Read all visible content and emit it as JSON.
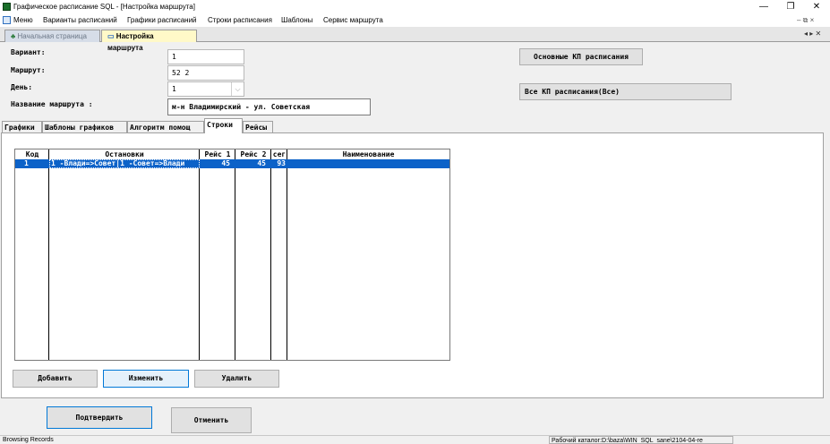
{
  "window": {
    "title": "Графическое расписание SQL - [Настройка маршрута]",
    "controls": [
      "—",
      "❐",
      "✕"
    ],
    "mdi_controls": "– ⧉ ×"
  },
  "menu": [
    "Меню",
    "Варианты расписаний",
    "Графики расписаний",
    "Строки расписания",
    "Шаблоны",
    "Сервис маршрута"
  ],
  "doc_tabs": {
    "start": "Начальная страница",
    "route": "Настройка маршрута",
    "nav": "◂ ▸ ✕"
  },
  "form": {
    "variant_label": "Вариант:",
    "variant_value": "1",
    "route_label": "Маршрут:",
    "route_value": "52  2",
    "day_label": "День:",
    "day_value": "1",
    "name_label": "Название маршрута :",
    "name_value": "м-н Владимирский - ул. Советская"
  },
  "buttons": {
    "main_kp": "Основные КП расписания",
    "all_kp": "Все КП расписания(Все)",
    "add": "Добавить",
    "edit": "Изменить",
    "delete": "Удалить",
    "confirm": "Подтвердить",
    "cancel": "Отменить"
  },
  "panel_tabs": [
    "Графики",
    "Шаблоны графиков",
    "Алгоритм помощ",
    "Строки",
    "Рейсы"
  ],
  "grid": {
    "columns": [
      "Код",
      "Остановки",
      "Рейс 1",
      "Рейс 2",
      "сег",
      "Наименование"
    ],
    "rows": [
      {
        "code": "1",
        "stops": "1 -Влади=>Совет|1 -Совет=>Влади",
        "trip1": "45",
        "trip2": "45",
        "seg": "93",
        "name": ""
      }
    ]
  },
  "status": {
    "left": "Browsing Records",
    "right": "Рабочий каталог:D:\\baza\\WIN_SQL_sane\\2104-04-re"
  },
  "colors": {
    "selection": "#0c62c8",
    "active_tab": "#fff9c8",
    "focus_border": "#0078d7"
  }
}
